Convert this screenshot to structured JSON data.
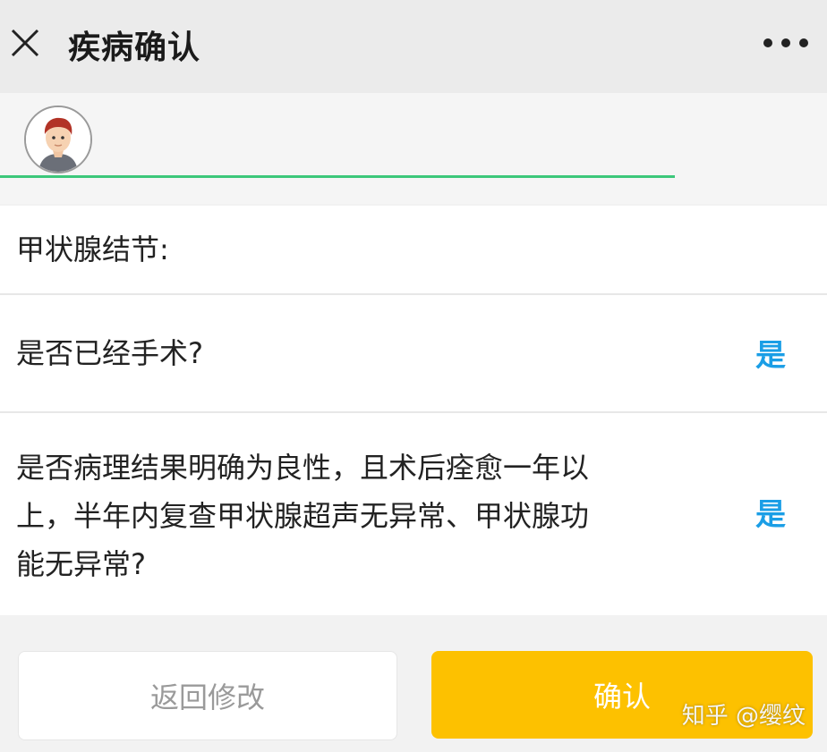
{
  "header": {
    "title": "疾病确认",
    "close_icon": "close-icon",
    "more_icon": "more-icon"
  },
  "questions": [
    {
      "label": "甲状腺结节:"
    },
    {
      "label": "是否已经手术?",
      "value": "是"
    },
    {
      "lines": [
        "是否病理结果明确为良性，且术后痊愈一年以",
        "上，半年内复查甲状腺超声无异常、甲状腺功",
        "能无异常?"
      ],
      "value": "是"
    }
  ],
  "actions": {
    "back_label": "返回修改",
    "confirm_label": "确认"
  },
  "watermark": "知乎 @缨纹",
  "colors": {
    "accent_green": "#3cc87a",
    "answer_blue": "#1a9ee6",
    "confirm_yellow": "#fdc100"
  }
}
